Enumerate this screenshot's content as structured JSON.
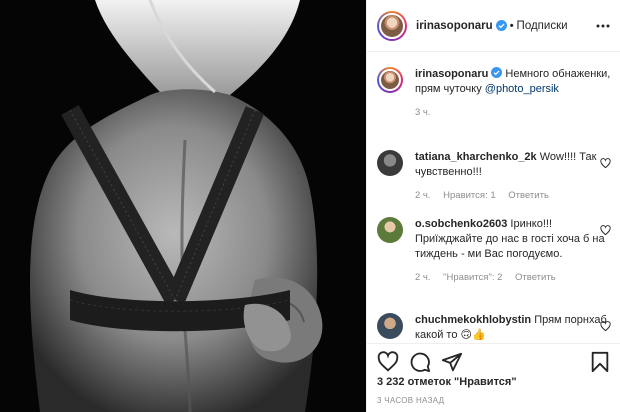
{
  "post": {
    "author": "irinasoponaru",
    "follow_label": "Подписки",
    "separator": "•",
    "caption": {
      "author": "irinasoponaru",
      "text": "Немного обнаженки, прям чуточку",
      "mention": "@photo_persik",
      "time": "3 ч."
    },
    "comments": [
      {
        "author": "tatiana_kharchenko_2k",
        "text": "Wow!!!! Так чувственно!!!",
        "time": "2 ч.",
        "likes": "Нравится: 1",
        "reply": "Ответить"
      },
      {
        "author": "o.sobchenko2603",
        "text": "Іринко!!! Приїжджайте до нас в гості хоча б на тиждень - ми Вас погодуємо.",
        "time": "2 ч.",
        "likes": "\"Нравится\": 2",
        "reply": "Ответить"
      },
      {
        "author": "chuchmekokhlobystin",
        "text": "Прям порнхаб какой то 🙃👍",
        "time": "",
        "likes": "",
        "reply": ""
      }
    ],
    "likes_count": "3 232 отметок \"Нравится\"",
    "timestamp": "3 ЧАСОВ НАЗАД"
  },
  "icons": [
    "verified-badge-icon",
    "more-options-icon",
    "heart-icon",
    "comment-icon",
    "share-icon",
    "bookmark-icon"
  ],
  "colors": {
    "verified": "#3897f0",
    "text": "#262626",
    "muted": "#8e8e8e",
    "mention": "#00376b",
    "border": "#efefef"
  }
}
